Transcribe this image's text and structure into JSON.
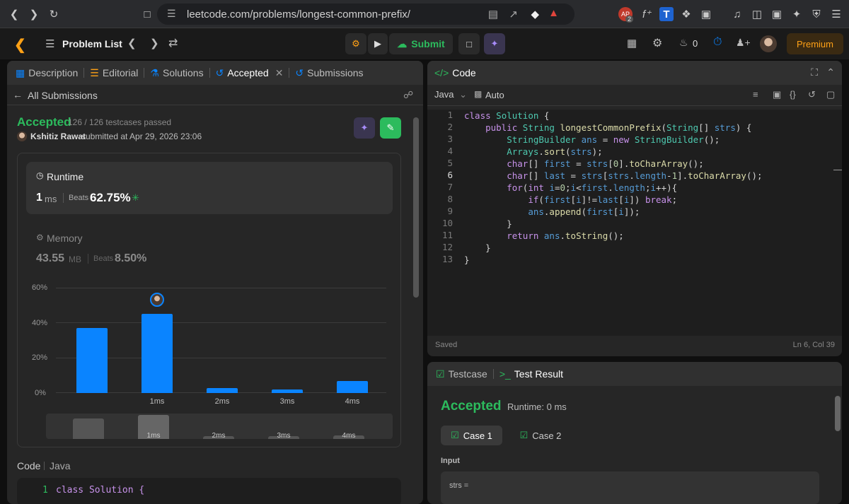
{
  "browser": {
    "url": "leetcode.com/problems/longest-common-prefix/",
    "badge_count": "2"
  },
  "topbar": {
    "problem_list_label": "Problem List",
    "submit_label": "Submit",
    "streak_count": "0",
    "premium_label": "Premium"
  },
  "left_tabs": {
    "description": "Description",
    "editorial": "Editorial",
    "solutions": "Solutions",
    "accepted": "Accepted",
    "submissions": "Submissions"
  },
  "submission": {
    "back_label": "All Submissions",
    "status": "Accepted",
    "testcases": "126 / 126 testcases passed",
    "user": "Kshitiz Rawat",
    "submitted_at": "submitted at Apr 29, 2026 23:06",
    "runtime_label": "Runtime",
    "runtime_value": "1",
    "runtime_unit": "ms",
    "beats_label": "Beats",
    "runtime_beats": "62.75%",
    "memory_label": "Memory",
    "memory_value": "43.55",
    "memory_unit": "MB",
    "memory_beats": "8.50%",
    "code_label": "Code",
    "lang_label": "Java",
    "preview_line_num": "1",
    "preview_line": "class Solution {"
  },
  "chart_data": {
    "type": "bar",
    "categories": [
      "",
      "1ms",
      "2ms",
      "3ms",
      "4ms"
    ],
    "values": [
      37,
      45,
      3,
      2,
      7
    ],
    "ylim": [
      0,
      60
    ],
    "yticks": [
      "0%",
      "20%",
      "40%",
      "60%"
    ],
    "highlight_index": 1,
    "grid": true,
    "color": "#0a84ff"
  },
  "editor": {
    "title": "Code",
    "language": "Java",
    "mode": "Auto",
    "status_saved": "Saved",
    "cursor_pos": "Ln 6, Col 39",
    "lines": [
      "class Solution {",
      "    public String longestCommonPrefix(String[] strs) {",
      "        StringBuilder ans = new StringBuilder();",
      "        Arrays.sort(strs);",
      "        char[] first = strs[0].toCharArray();",
      "        char[] last = strs[strs.length-1].toCharArray();",
      "        for(int i=0;i<first.length;i++){",
      "            if(first[i]!=last[i]) break;",
      "            ans.append(first[i]);",
      "        }",
      "        return ans.toString();",
      "    }",
      "}"
    ]
  },
  "result": {
    "testcase_tab": "Testcase",
    "result_tab": "Test Result",
    "status": "Accepted",
    "runtime": "Runtime: 0 ms",
    "case1": "Case 1",
    "case2": "Case 2",
    "input_label": "Input",
    "input_value": "strs ="
  }
}
